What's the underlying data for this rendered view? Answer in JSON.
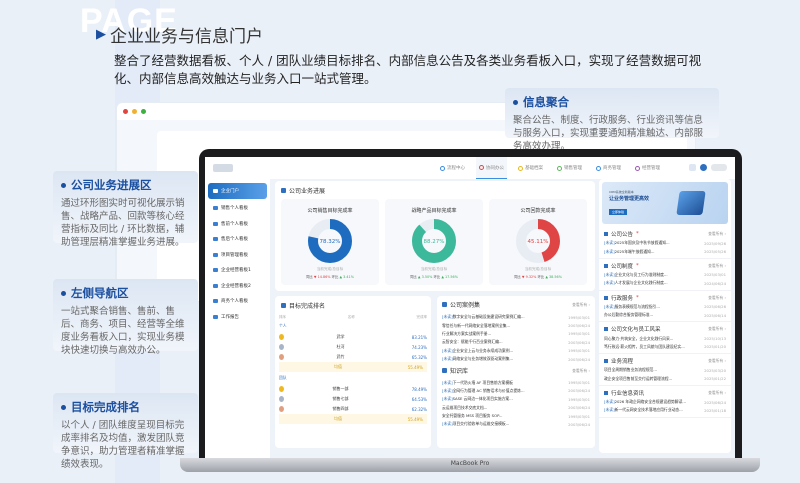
{
  "watermark": "PAGE",
  "title": "企业业务与信息门户",
  "description": "整合了经营数据看板、个人 / 团队业绩目标排名、内部信息公告及各类业务看板入口，实现了经营数据可视化、内部信息高效触达与业务入口一站式管理。",
  "callouts": [
    {
      "title": "信息聚合",
      "text": "聚合公告、制度、行政服务、行业资讯等信息与服务入口，实现重要通知精准触达、内部服务高效办理。"
    },
    {
      "title": "公司业务进展区",
      "text": "通过环形图实时可视化展示销售、战略产品、回款等核心经营指标及同比 / 环比数据，辅助管理层精准掌握业务进展。"
    },
    {
      "title": "左侧导航区",
      "text": "一站式聚合销售、售前、售后、商务、项目、经营等全维度业务看板入口，实现业务模块快速切换与高效办公。"
    },
    {
      "title": "目标完成排名",
      "text": "以个人 / 团队维度呈现目标完成率排名及均值，激发团队竞争意识，助力管理者精准掌握绩效表现。"
    }
  ],
  "laptop_label": "MacBook Pro",
  "app": {
    "nav": [
      {
        "label": "流程中心",
        "color": "#3a8ee0"
      },
      {
        "label": "协同办公",
        "color": "#e04545",
        "active": true
      },
      {
        "label": "基础档案",
        "color": "#e8b820"
      },
      {
        "label": "销售管理",
        "color": "#5cb85c"
      },
      {
        "label": "商务管理",
        "color": "#3a8ee0"
      },
      {
        "label": "经营管理",
        "color": "#9b59b6"
      }
    ],
    "sidebar": [
      "企业门户",
      "销售个人看板",
      "售前个人看板",
      "售后个人看板",
      "项目管理看板",
      "企业经营看板1",
      "企业经营看板2",
      "商务个人看板",
      "工作报告"
    ],
    "progress": {
      "title": "公司业务进展",
      "subtitle": "当前完成/总目标",
      "yoy": "同比",
      "mom": "环比",
      "kpis": [
        {
          "title": "公司销售目标完成率",
          "value": "78.32%",
          "fraction": 0.7832,
          "color": "#1e6cc0",
          "yoy": "14.86%",
          "yoy_dir": "down",
          "mom": "3.41%",
          "mom_dir": "up"
        },
        {
          "title": "战略产品目标完成率",
          "value": "88.27%",
          "fraction": 0.8827,
          "color": "#3cb89a",
          "yoy": "3.50%",
          "yoy_dir": "up",
          "mom": "17.56%",
          "mom_dir": "up"
        },
        {
          "title": "公司回款完成率",
          "value": "45.11%",
          "fraction": 0.4511,
          "color": "#e04545",
          "yoy": "9.32%",
          "yoy_dir": "down",
          "mom": "38.56%",
          "mom_dir": "up"
        }
      ]
    },
    "ranking": {
      "title": "目标完成排名",
      "cols": [
        "排序",
        "名称",
        "完成率"
      ],
      "avg_label": "均值",
      "groups": [
        {
          "label": "个人",
          "rows": [
            {
              "name": "武学",
              "value": "83.21%"
            },
            {
              "name": "杜河",
              "value": "74.23%"
            },
            {
              "name": "武竹",
              "value": "65.32%"
            }
          ],
          "avg": "55.49%"
        },
        {
          "label": "团队",
          "rows": [
            {
              "name": "销售一部",
              "value": "78.49%"
            },
            {
              "name": "销售七部",
              "value": "64.53%"
            },
            {
              "name": "销售四部",
              "value": "62.32%"
            }
          ],
          "avg": "55.49%"
        }
      ]
    },
    "cases": {
      "title": "公司案例集",
      "more": "查看所有 ›",
      "items": [
        {
          "tag": "[未读]",
          "text": "数字安全与云基础设施建设研究案例汇编...",
          "date": "1995/03/01"
        },
        {
          "tag": "",
          "text": "零信任与新一代网络安全落地案例全集...",
          "date": "2003/06/24"
        },
        {
          "tag": "",
          "text": "行业解决方案实战案例手册...",
          "date": "1995/03/01"
        },
        {
          "tag": "",
          "text": "云智安全：赋能千行百业案例汇编...",
          "date": "2003/06/24"
        },
        {
          "tag": "[未读]",
          "text": "企业安全上云与业务永续成功案例...",
          "date": "1995/03/01"
        },
        {
          "tag": "[未读]",
          "text": "网络安全与业务增效双驱动案例集...",
          "date": "2003/06/24"
        }
      ]
    },
    "kb": {
      "title": "知识库",
      "more": "查看所有 ›",
      "items": [
        {
          "tag": "[未读]",
          "text": "下一代防火墙 AF 项目售前方案模板",
          "date": "1995/03/01"
        },
        {
          "tag": "[未读]",
          "text": "全网行为管理 AC 销售话术与价值点提炼...",
          "date": "2003/06/24"
        },
        {
          "tag": "[未读]",
          "text": "SASE 云网边一体化项目实施方案...",
          "date": "1995/03/01"
        },
        {
          "tag": "",
          "text": "云运维项目技术交底文档...",
          "date": "2003/06/24"
        },
        {
          "tag": "",
          "text": "安全托管服务 MSS 项目服务 SOP...",
          "date": "1995/03/01"
        },
        {
          "tag": "[未读]",
          "text": "项目交付验收单与运维交接模板...",
          "date": "2003/06/24"
        }
      ]
    },
    "banner": {
      "small": "CRM系统全新版本",
      "headline": "让业务管理更高效",
      "button": "立即体验"
    },
    "info": [
      {
        "title": "公司公告",
        "star": true,
        "items": [
          {
            "tag": "[未读]",
            "text": "2025年国庆及中秋节放假通知...",
            "date": "2025/09/26"
          },
          {
            "tag": "[未读]",
            "text": "2025年端午放假通知...",
            "date": "2025/05/26"
          }
        ]
      },
      {
        "title": "公司制度",
        "star": true,
        "items": [
          {
            "tag": "[未读]",
            "text": "企业文化与员工行为准则制度...",
            "date": "2025/03/01"
          },
          {
            "tag": "[未读]",
            "text": "人才发展与企业文化践行制度...",
            "date": "2024/06/24"
          }
        ]
      },
      {
        "title": "行政服务",
        "star": true,
        "items": [
          {
            "tag": "[未读]",
            "text": "服务表模规范与流程指引...",
            "date": "2025/06/26"
          },
          {
            "tag": "",
            "text": "办公后勤综合服务管理标准...",
            "date": "2025/06/14"
          }
        ]
      },
      {
        "title": "公司文化与员工风采",
        "star": false,
        "items": [
          {
            "tag": "",
            "text": "同心聚力·共筑安全，企业文化践行风采...",
            "date": "2025/10/13"
          },
          {
            "tag": "",
            "text": "笃行致远·薪火相传，员工风貌与团队建设纪实...",
            "date": "2025/01/20"
          }
        ]
      },
      {
        "title": "业务流程",
        "star": false,
        "items": [
          {
            "tag": "",
            "text": "项目全周期销售业务流程规范...",
            "date": "2025/03/20"
          },
          {
            "tag": "",
            "text": "政企安全项目售前至交付运转管理流程...",
            "date": "2025/01/22"
          }
        ]
      },
      {
        "title": "行业信息资讯",
        "star": false,
        "items": [
          {
            "tag": "[未读]",
            "text": "2026 年政企网络安全合规建设趋势解读...",
            "date": "2025/06/24"
          },
          {
            "tag": "[未读]",
            "text": "新一代云网安全技术落地应用行业动态...",
            "date": "2025/01/18"
          }
        ]
      }
    ],
    "more": "查看所有 ›"
  }
}
